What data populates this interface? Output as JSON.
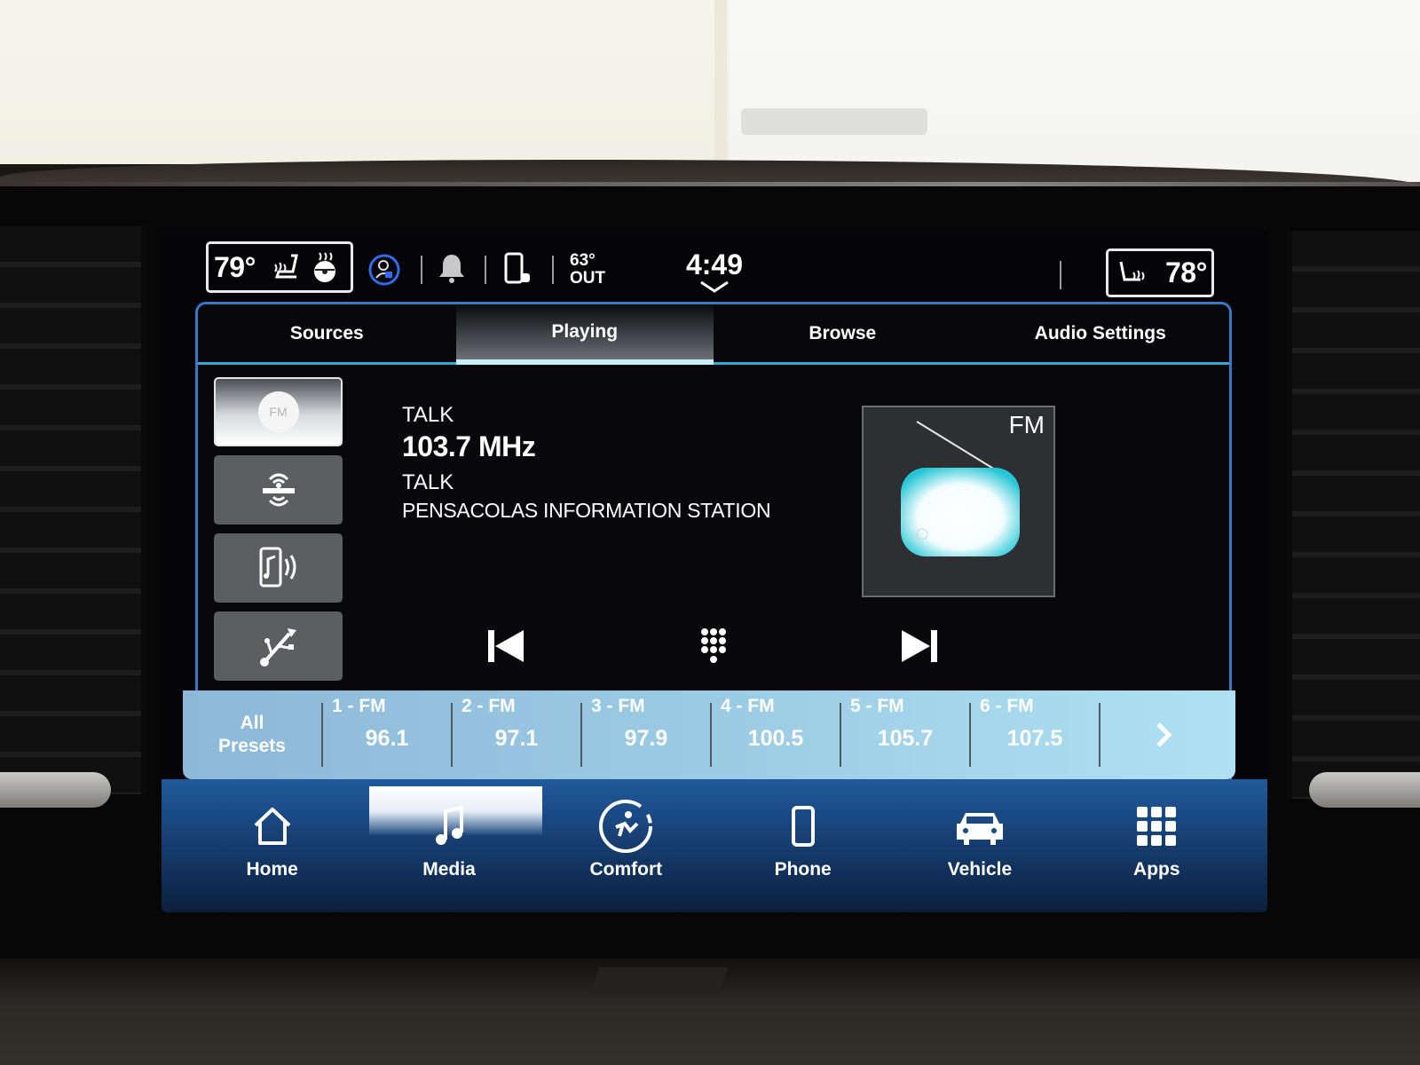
{
  "status_bar": {
    "driver_temp": "79°",
    "passenger_temp": "78°",
    "outside_temp": "63°",
    "outside_label": "OUT",
    "clock": "4:49",
    "icons": [
      "heated-seat-icon",
      "heated-steering-wheel-icon",
      "driver-profile-icon",
      "notification-bell-icon",
      "phone-connected-icon",
      "passenger-heated-seat-icon"
    ]
  },
  "tabs": [
    {
      "label": "Sources",
      "active": false
    },
    {
      "label": "Playing",
      "active": true
    },
    {
      "label": "Browse",
      "active": false
    },
    {
      "label": "Audio Settings",
      "active": false
    }
  ],
  "sources": [
    {
      "name": "fm-radio",
      "label": "FM",
      "active": true
    },
    {
      "name": "siriusxm",
      "label": "SiriusXM",
      "active": false
    },
    {
      "name": "bluetooth-audio",
      "label": "Bluetooth",
      "active": false
    },
    {
      "name": "usb",
      "label": "USB",
      "active": false
    }
  ],
  "now_playing": {
    "genre": "TALK",
    "frequency": "103.7 MHz",
    "program_type": "TALK",
    "station_name": "PENSACOLAS INFORMATION STATION",
    "band": "FM"
  },
  "transport": {
    "prev": "seek-previous",
    "keypad": "direct-tune-keypad",
    "next": "seek-next"
  },
  "presets": {
    "all_label_line1": "All",
    "all_label_line2": "Presets",
    "items": [
      {
        "label": "1 - FM",
        "value": "96.1"
      },
      {
        "label": "2 - FM",
        "value": "97.1"
      },
      {
        "label": "3 - FM",
        "value": "97.9"
      },
      {
        "label": "4 - FM",
        "value": "100.5"
      },
      {
        "label": "5 - FM",
        "value": "105.7"
      },
      {
        "label": "6 - FM",
        "value": "107.5"
      }
    ]
  },
  "bottom_nav": [
    {
      "label": "Home",
      "icon": "home-icon",
      "active": false
    },
    {
      "label": "Media",
      "icon": "music-note-icon",
      "active": true
    },
    {
      "label": "Comfort",
      "icon": "comfort-seat-icon",
      "active": false
    },
    {
      "label": "Phone",
      "icon": "phone-icon",
      "active": false
    },
    {
      "label": "Vehicle",
      "icon": "car-icon",
      "active": false
    },
    {
      "label": "Apps",
      "icon": "apps-grid-icon",
      "active": false
    }
  ],
  "colors": {
    "accent_blue": "#3b77c8",
    "tab_underline": "#35a8d8",
    "preset_bar": "#9bcbe4",
    "nav_bar": "#173f73",
    "radio_teal": "#27c6d6"
  }
}
